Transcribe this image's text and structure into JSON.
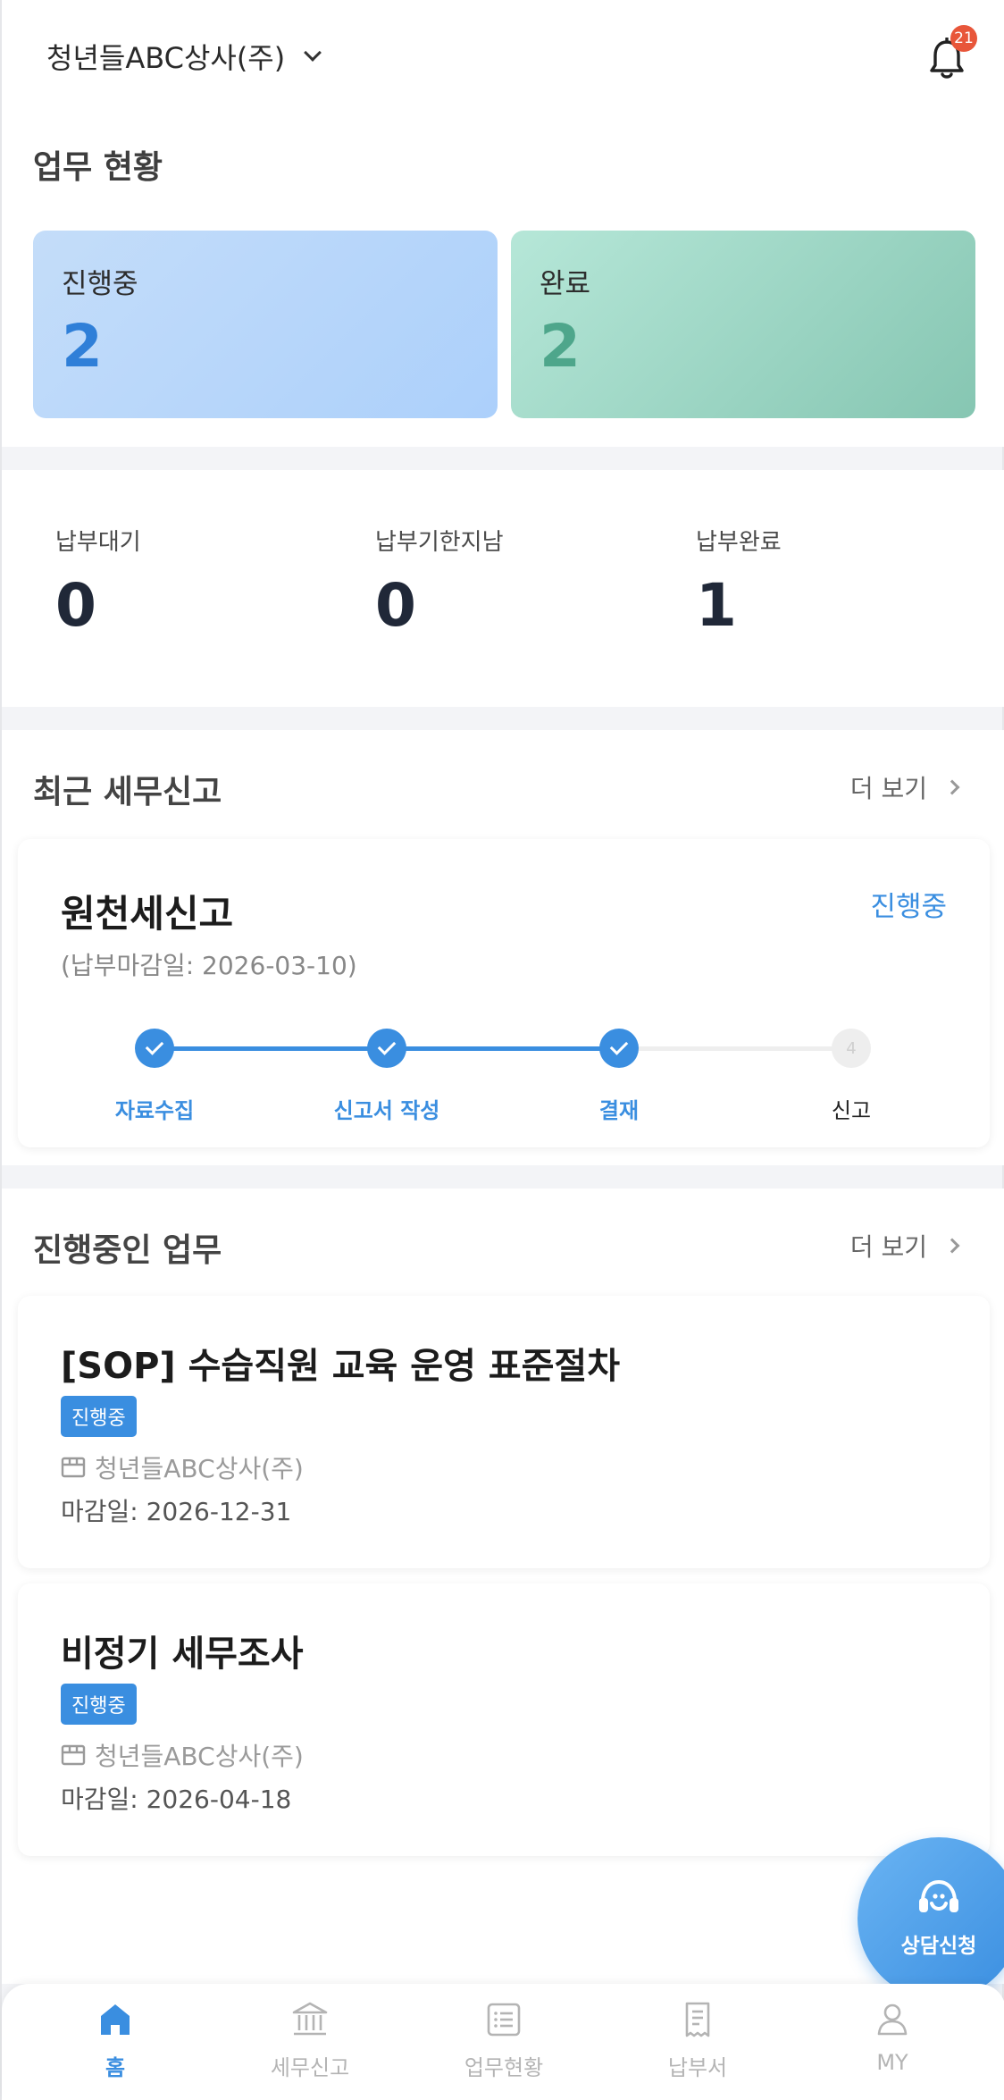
{
  "header": {
    "company": "청년들ABC상사(주)",
    "notification_count": "21"
  },
  "status": {
    "title": "업무 현황",
    "in_progress": {
      "label": "진행중",
      "value": "2"
    },
    "completed": {
      "label": "완료",
      "value": "2"
    }
  },
  "payments": [
    {
      "label": "납부대기",
      "value": "0"
    },
    {
      "label": "납부기한지남",
      "value": "0"
    },
    {
      "label": "납부완료",
      "value": "1"
    }
  ],
  "recent_tax": {
    "title": "최근 세무신고",
    "more": "더 보기",
    "card": {
      "name": "원천세신고",
      "status": "진행중",
      "deadline": "(납부마감일: 2026-03-10)",
      "steps": [
        {
          "label": "자료수집",
          "state": "done"
        },
        {
          "label": "신고서 작성",
          "state": "done"
        },
        {
          "label": "결재",
          "state": "done"
        },
        {
          "label": "신고",
          "state": "todo",
          "number": "4"
        }
      ]
    }
  },
  "ongoing": {
    "title": "진행중인 업무",
    "more": "더 보기",
    "tasks": [
      {
        "title": "[SOP] 수습직원 교육 운영 표준절차",
        "badge": "진행중",
        "company": "청년들ABC상사(주)",
        "due": "마감일: 2026-12-31"
      },
      {
        "title": "비정기 세무조사",
        "badge": "진행중",
        "company": "청년들ABC상사(주)",
        "due": "마감일: 2026-04-18"
      }
    ]
  },
  "fab": {
    "label": "상담신청",
    "icon": "headset-icon"
  },
  "nav": [
    {
      "label": "홈",
      "icon": "home-icon",
      "active": true
    },
    {
      "label": "세무신고",
      "icon": "bank-icon",
      "active": false
    },
    {
      "label": "업무현황",
      "icon": "list-icon",
      "active": false
    },
    {
      "label": "납부서",
      "icon": "receipt-icon",
      "active": false
    },
    {
      "label": "MY",
      "icon": "user-icon",
      "active": false
    }
  ],
  "colors": {
    "accent": "#3a8ee0",
    "badge": "#e8563a",
    "progress_card": "#b8d6fa",
    "done_card": "#9fd8c6"
  }
}
